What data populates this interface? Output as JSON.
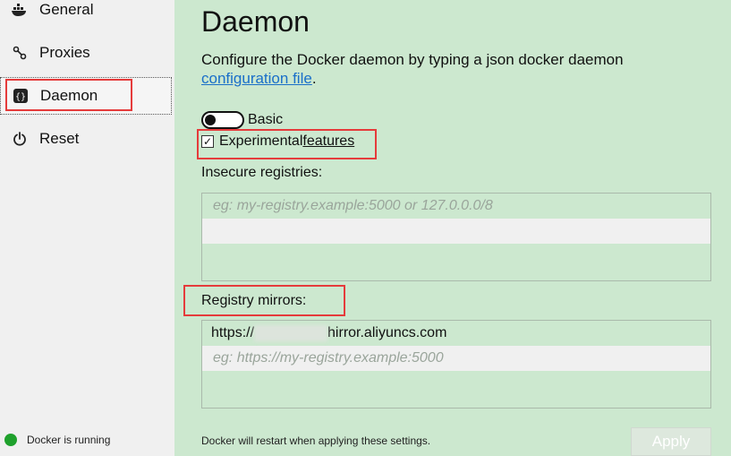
{
  "sidebar": {
    "items": [
      {
        "label": "General",
        "icon": "docker-whale-icon"
      },
      {
        "label": "Proxies",
        "icon": "proxies-icon"
      },
      {
        "label": "Daemon",
        "icon": "braces-icon",
        "selected": true
      },
      {
        "label": "Reset",
        "icon": "power-icon"
      }
    ],
    "status": {
      "text": "Docker is running",
      "color": "#1fa12c"
    }
  },
  "main": {
    "title": "Daemon",
    "description": "Configure the Docker daemon by typing a json docker daemon ",
    "description_link": "configuration file",
    "description_end": ".",
    "toggle_label": "Basic",
    "experimental_label": "Experimental ",
    "experimental_link": "features",
    "experimental_checked": true,
    "insecure": {
      "label": "Insecure registries:",
      "placeholder": "eg: my-registry.example:5000 or 127.0.0.0/8"
    },
    "mirrors": {
      "label": "Registry mirrors:",
      "value_prefix": "https://",
      "value_suffix": "hirror.aliyuncs.com",
      "placeholder": "eg: https://my-registry.example:5000"
    },
    "footer_note": "Docker will restart when applying these settings.",
    "apply_label": "Apply"
  },
  "colors": {
    "content_bg": "#cce8cf",
    "sidebar_bg": "#f0f0f0",
    "link": "#1a6fc9",
    "annotation": "#e53b3b"
  }
}
